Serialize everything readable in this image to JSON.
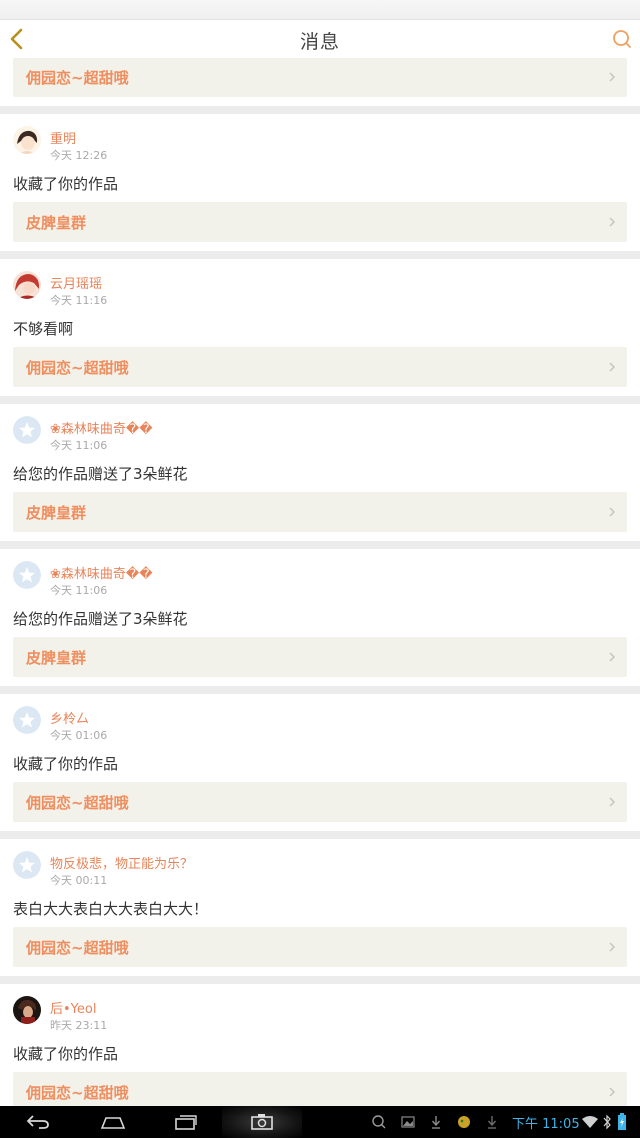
{
  "header": {
    "title": "消息"
  },
  "partial_card": {
    "link": "佣园恋~超甜哦"
  },
  "messages": [
    {
      "user": "重明",
      "time": "今天 12:26",
      "text": "收藏了你的作品",
      "link": "皮脾皇群",
      "avatar": "avatar-girl"
    },
    {
      "user": "云月瑶瑶",
      "time": "今天 11:16",
      "text": "不够看啊",
      "link": "佣园恋~超甜哦",
      "avatar": "avatar-red"
    },
    {
      "user": "❀森林味曲奇��",
      "time": "今天 11:06",
      "text": "给您的作品赠送了3朵鲜花",
      "link": "皮脾皇群",
      "avatar": "default-star"
    },
    {
      "user": "❀森林味曲奇��",
      "time": "今天 11:06",
      "text": "给您的作品赠送了3朵鲜花",
      "link": "皮脾皇群",
      "avatar": "default-star"
    },
    {
      "user": "乡柃厶",
      "time": "今天 01:06",
      "text": "收藏了你的作品",
      "link": "佣园恋~超甜哦",
      "avatar": "default-star"
    },
    {
      "user": "物反极悲，物正能为乐？",
      "time": "今天 00:11",
      "text": "表白大大表白大大表白大大！",
      "link": "佣园恋~超甜哦",
      "avatar": "default-star"
    },
    {
      "user": "后•Yeol",
      "time": "昨天 23:11",
      "text": "收藏了你的作品",
      "link": "佣园恋~超甜哦",
      "avatar": "avatar-dark"
    }
  ],
  "statusbar": {
    "clock": "下午 11:05"
  },
  "colors": {
    "accent": "#ef8e5f",
    "username": "#e8845a",
    "link_bg": "#f3f2ea",
    "clock": "#3fb4e8"
  }
}
